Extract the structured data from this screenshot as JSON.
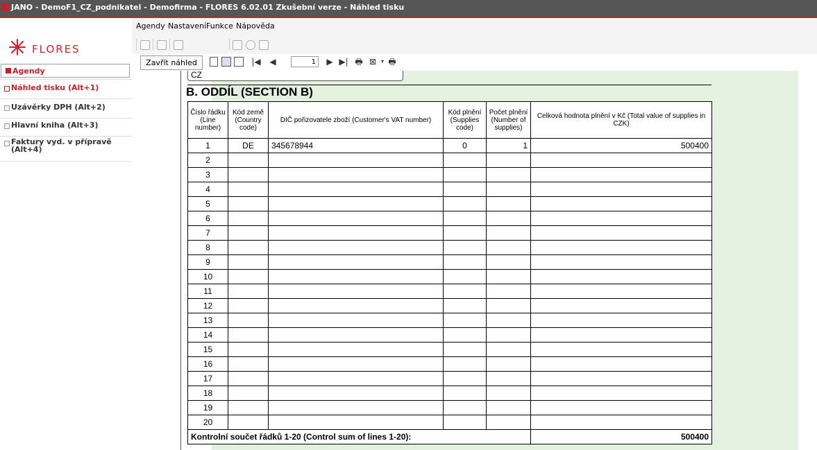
{
  "window": {
    "title": "JANO - DemoF1_CZ_podnikatel - Demofirma - FLORES 6.02.01 Zkušební verze - Náhled tisku"
  },
  "logo": {
    "text": "FLORES"
  },
  "sidebar": {
    "items": [
      {
        "label": "Agendy"
      },
      {
        "label": "Náhled tisku (Alt+1)"
      },
      {
        "label": "Uzávěrky DPH (Alt+2)"
      },
      {
        "label": "Hlavní kniha (Alt+3)"
      },
      {
        "label": "Faktury vyd. v přípravě\n(Alt+4)"
      }
    ]
  },
  "menu": {
    "items": [
      "Agendy",
      "Nastavení",
      "Funkce",
      "Nápověda"
    ]
  },
  "toolbar": {
    "close_preview": "Zavřít náhled",
    "page_number": "1"
  },
  "document": {
    "country_box": "CZ",
    "section_title": "B. ODDÍL (SECTION B)",
    "headers": [
      "Číslo řádku (Line number)",
      "Kód země (Country code)",
      "DIČ pořizovatele zboží (Customer's VAT number)",
      "Kód plnění (Supplies code)",
      "Počet plnění (Number of supplies)",
      "Celková hodnota plnění v Kč (Total value of supplies in CZK)"
    ],
    "rows": [
      {
        "line": "1",
        "country": "DE",
        "vat": "345678944",
        "code": "0",
        "count": "1",
        "total": "500400"
      },
      {
        "line": "2",
        "country": "",
        "vat": "",
        "code": "",
        "count": "",
        "total": ""
      },
      {
        "line": "3",
        "country": "",
        "vat": "",
        "code": "",
        "count": "",
        "total": ""
      },
      {
        "line": "4",
        "country": "",
        "vat": "",
        "code": "",
        "count": "",
        "total": ""
      },
      {
        "line": "5",
        "country": "",
        "vat": "",
        "code": "",
        "count": "",
        "total": ""
      },
      {
        "line": "6",
        "country": "",
        "vat": "",
        "code": "",
        "count": "",
        "total": ""
      },
      {
        "line": "7",
        "country": "",
        "vat": "",
        "code": "",
        "count": "",
        "total": ""
      },
      {
        "line": "8",
        "country": "",
        "vat": "",
        "code": "",
        "count": "",
        "total": ""
      },
      {
        "line": "9",
        "country": "",
        "vat": "",
        "code": "",
        "count": "",
        "total": ""
      },
      {
        "line": "10",
        "country": "",
        "vat": "",
        "code": "",
        "count": "",
        "total": ""
      },
      {
        "line": "11",
        "country": "",
        "vat": "",
        "code": "",
        "count": "",
        "total": ""
      },
      {
        "line": "12",
        "country": "",
        "vat": "",
        "code": "",
        "count": "",
        "total": ""
      },
      {
        "line": "13",
        "country": "",
        "vat": "",
        "code": "",
        "count": "",
        "total": ""
      },
      {
        "line": "14",
        "country": "",
        "vat": "",
        "code": "",
        "count": "",
        "total": ""
      },
      {
        "line": "15",
        "country": "",
        "vat": "",
        "code": "",
        "count": "",
        "total": ""
      },
      {
        "line": "16",
        "country": "",
        "vat": "",
        "code": "",
        "count": "",
        "total": ""
      },
      {
        "line": "17",
        "country": "",
        "vat": "",
        "code": "",
        "count": "",
        "total": ""
      },
      {
        "line": "18",
        "country": "",
        "vat": "",
        "code": "",
        "count": "",
        "total": ""
      },
      {
        "line": "19",
        "country": "",
        "vat": "",
        "code": "",
        "count": "",
        "total": ""
      },
      {
        "line": "20",
        "country": "",
        "vat": "",
        "code": "",
        "count": "",
        "total": ""
      }
    ],
    "sum_label": "Kontrolní součet řádků 1-20 (Control sum of lines 1-20):",
    "sum_value": "500400"
  },
  "colors": {
    "accent": "#c8202a",
    "page_green": "#e3f2df",
    "titlebar": "#555555"
  }
}
